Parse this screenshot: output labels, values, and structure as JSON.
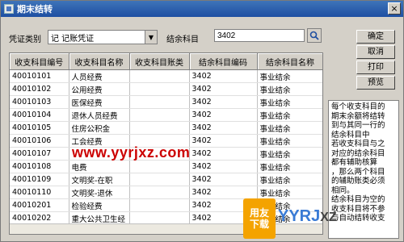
{
  "window": {
    "title": "期末结转",
    "close_glyph": "×"
  },
  "filters": {
    "voucher_type_label": "凭证类别",
    "voucher_type_value": "记  记账凭证",
    "balance_subject_label": "结余科目",
    "balance_subject_value": "3402"
  },
  "buttons": {
    "confirm": "确定",
    "cancel": "取消",
    "print": "打印",
    "preview": "预览"
  },
  "table": {
    "columns": [
      "收支科目编号",
      "收支科目名称",
      "收支科目账类",
      "结余科目编码",
      "结余科目名称"
    ],
    "rows": [
      [
        "40010101",
        "人员经费",
        "",
        "3402",
        "事业结余"
      ],
      [
        "40010102",
        "公用经费",
        "",
        "3402",
        "事业结余"
      ],
      [
        "40010103",
        "医保经费",
        "",
        "3402",
        "事业结余"
      ],
      [
        "40010104",
        "退休人员经费",
        "",
        "3402",
        "事业结余"
      ],
      [
        "40010105",
        "住房公积金",
        "",
        "3402",
        "事业结余"
      ],
      [
        "40010106",
        "工会经费",
        "",
        "3402",
        "事业结余"
      ],
      [
        "40010107",
        "",
        "",
        "3402",
        "事业结余"
      ],
      [
        "40010108",
        "电费",
        "",
        "3402",
        "事业结余"
      ],
      [
        "40010109",
        "文明奖-在职",
        "",
        "3402",
        "事业结余"
      ],
      [
        "40010110",
        "文明奖-退休",
        "",
        "3402",
        "事业结余"
      ],
      [
        "40010201",
        "检验经费",
        "",
        "3402",
        "事业结余"
      ],
      [
        "40010202",
        "重大公共卫生经",
        "",
        "3402",
        "事业结余"
      ],
      [
        "",
        "",
        "",
        "3402",
        "事业结余"
      ]
    ]
  },
  "note": {
    "lines": [
      "每个收支科目的",
      "期末余额将结转",
      "到与其同一行的",
      "结余科目中",
      "若收支科目与之",
      "对应的结余科目",
      "都有辅助核算",
      "，那么两个科目",
      "的辅助账类必须",
      "相同。",
      "结余科目为空的",
      "收支科目将不参",
      "与自动结转收支"
    ]
  },
  "watermark": {
    "url": "www.yyrjxz.com"
  },
  "logo": {
    "top": "用友",
    "bottom": "下载",
    "text": "YYRJ",
    "suffix": "XZ"
  },
  "icons": {
    "search": "search-icon",
    "dropdown": "chevron-down-icon"
  }
}
